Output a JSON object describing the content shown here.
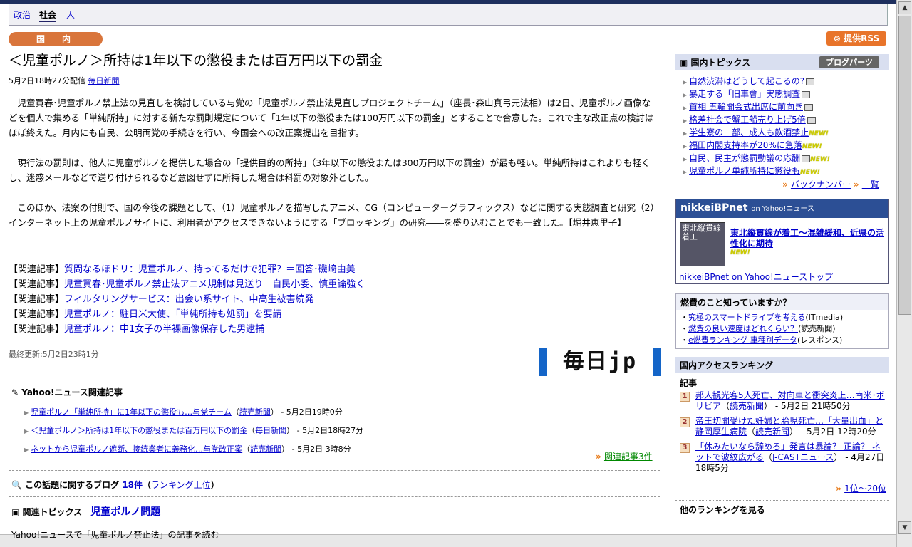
{
  "nav": {
    "tabs": [
      "政治",
      "社会",
      "人"
    ],
    "active": "社会"
  },
  "category": "国　内",
  "rss_label": "提供RSS",
  "article": {
    "title": "＜児童ポルノ＞所持は1年以下の懲役または百万円以下の罰金",
    "date": "5月2日18時27分配信",
    "source": "毎日新聞",
    "paragraphs": [
      "児童買春･児童ポルノ禁止法の見直しを検討している与党の「児童ポルノ禁止法見直しプロジェクトチーム」（座長･森山真弓元法相）は2日、児童ポルノ画像などを個人で集める「単純所持」に対する新たな罰則規定について「1年以下の懲役または100万円以下の罰金」とすることで合意した。これで主な改正点の検討はほぼ終えた。月内にも自民、公明両党の手続きを行い、今国会への改正案提出を目指す。",
      "現行法の罰則は、他人に児童ポルノを提供した場合の「提供目的の所持」（3年以下の懲役または300万円以下の罰金）が最も軽い。単純所持はこれよりも軽くし、迷惑メールなどで送り付けられるなど意図せずに所持した場合は科罰の対象外とした。",
      "このほか、法案の付則で、国の今後の課題として、（1）児童ポルノを描写したアニメ、CG（コンピューターグラフィックス）などに関する実態調査と研究（2）インターネット上の児童ポルノサイトに、利用者がアクセスできないようにする「ブロッキング」の研究――を盛り込むことでも一致した。【堀井恵里子】"
    ],
    "related_prefix": "【関連記事】",
    "related": [
      "質問なるほドリ：児童ポルノ、持ってるだけで犯罪？＝回答･磯崎由美",
      "児童買春･児童ポルノ禁止法アニメ規制は見送り　自民小委、慎重論強く",
      "フィルタリングサービス：出会い系サイト、中高生被害続発",
      "児童ポルノ：駐日米大使、「単純所持も処罰」を要請",
      "児童ポルノ：中1女子の半裸画像保存した男逮捕"
    ],
    "updated": "最終更新:5月2日23時1分",
    "logo": "毎日jp"
  },
  "yahoo_related": {
    "heading": "Yahoo!ニュース関連記事",
    "items": [
      {
        "title": "児童ポルノ「単純所持」に1年以下の懲役も…与党チーム",
        "source": "読売新聞",
        "time": " - 5月2日19時0分"
      },
      {
        "title": "＜児童ポルノ＞所持は1年以下の懲役または百万円以下の罰金",
        "source": "毎日新聞",
        "time": " - 5月2日18時27分"
      },
      {
        "title": "ネットから児童ポルノ遮断、接続業者に義務化…与党改正案",
        "source": "読売新聞",
        "time": " - 5月2日 3時8分"
      }
    ],
    "more": "関連記事3件"
  },
  "blog": {
    "label": "この話題に関するブログ",
    "count": "18件",
    "ranking": "ランキング上位"
  },
  "topics": {
    "label": "関連トピックス",
    "link": "児童ポルノ問題"
  },
  "cut_text": "Yahoo!ニュースで「児童ポルノ禁止法」の記事を読む",
  "sidebar": {
    "domestic_topics": {
      "title": "国内トピックス",
      "blogparts": "ブログパーツ",
      "items": [
        {
          "text": "自然渋滞はどうして起こるの?",
          "cam": true,
          "new": false
        },
        {
          "text": "暴走する「旧車會」実態調査",
          "cam": true,
          "new": false
        },
        {
          "text": "首相 五輪開会式出席に前向き",
          "cam": true,
          "new": false
        },
        {
          "text": "格差社会で蟹工船売り上げ5倍",
          "cam": true,
          "new": false
        },
        {
          "text": "学生寮の一部、成人も飲酒禁止",
          "cam": false,
          "new": true
        },
        {
          "text": "福田内閣支持率が20%に急落",
          "cam": false,
          "new": true
        },
        {
          "text": "自民、民主が懲罰動議の応酬",
          "cam": true,
          "new": true
        },
        {
          "text": "児童ポルノ単純所持に懲役も",
          "cam": false,
          "new": true
        }
      ],
      "backnumber": "バックナンバー",
      "list": "一覧",
      "new_label": "NEW!"
    },
    "nikkei": {
      "brand": "nikkeiBPnet",
      "brand_suffix": "on Yahoo!ニュース",
      "img_text": "東北縦貫線着工",
      "title": "東北縦貫線が着工～混雑緩和、近県の活性化に期待",
      "footer": "nikkeiBPnet on Yahoo!ニューストップ"
    },
    "fuel": {
      "title": "燃費のこと知っていますか？",
      "items": [
        {
          "text": "究極のスマートドライブを考える",
          "source": "(ITmedia)"
        },
        {
          "text": "燃費の良い速度はどれくらい？",
          "source": "(読売新聞)"
        },
        {
          "text": "e燃費ランキング 車種別データ",
          "source": "(レスポンス)"
        }
      ]
    },
    "ranking": {
      "title": "国内アクセスランキング",
      "sub": "記事",
      "items": [
        {
          "num": "1",
          "text": "邦人観光客5人死亡、対向車と衝突炎上…南米･ボリビア",
          "source": "読売新聞",
          "time": " - 5月2日 21時50分"
        },
        {
          "num": "2",
          "text": "帝王切開受けた妊婦と胎児死亡…「大量出血」と静岡厚生病院",
          "source": "読売新聞",
          "time": " - 5月2日 12時20分"
        },
        {
          "num": "3",
          "text": "「休みたいなら辞めろ」発言は暴論？ 正論？ ネットで波紋広がる",
          "source": "J-CASTニュース",
          "time": " - 4月27日 18時5分"
        }
      ],
      "more": "1位～20位",
      "others": "他のランキングを見る"
    }
  }
}
